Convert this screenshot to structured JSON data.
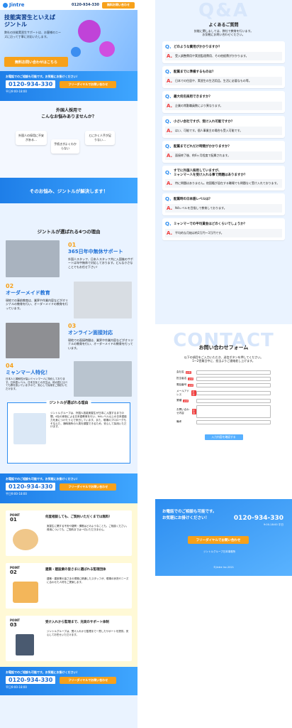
{
  "header": {
    "brand": "Jintre",
    "phone": "0120-934-330",
    "cta": "無料お問い合わせ"
  },
  "hero": {
    "title": "技能実習生といえば\nジントル",
    "sub": "弊社の技能実習生サポートは、お客様のニーズに沿って丁寧に対応いたします。",
    "cta": "無料お問い合わせはこちら"
  },
  "cta_band": {
    "lead": "お電話でのご相談も可能です。お気軽にお掛けください！",
    "phone": "0120-934-330",
    "hours": "平日9:00-18:00",
    "button": "フリーダイヤルでお問い合わせ"
  },
  "worries": {
    "title": "外国人採用で\nこんなお悩みありませんか？",
    "items": [
      "外国人の採用に不安がある…",
      "手続きがよくわからない",
      "とにかく人手が足りない…"
    ],
    "answer": "そのお悩み、ジントルが解決します！"
  },
  "reasons": {
    "title": "ジントルが選ばれる4つの理由",
    "items": [
      {
        "num": "01",
        "title": "365日年中無休サポート",
        "body": "外国人スタッフ、日本人スタッフ共に入国後のサポートは年中無休で対応しております。どんな小さなことでもお任せ下さい！"
      },
      {
        "num": "02",
        "title": "オーダーメイド教育",
        "body": "現地での事前教育は、業界や作業内容などがオリジナルの教育を行い、オーダーメイドの教育を行っています。"
      },
      {
        "num": "03",
        "title": "オンライン面接対応",
        "body": "現地での面接時間は、業界や作業内容などがオリジナルの教育を行い、オーダーメイドの教育を行っています。"
      },
      {
        "num": "04",
        "title": "ミャンマー人特化！",
        "body": "日本人と親和性が高いミャンマー人に特化しております。日本語レベル、日本文化との共生は、他の国と比べても群を抜いていますので、安心して採用をご検討いただけます。"
      }
    ]
  },
  "chosen": {
    "title": "ジントルが選ばれる理由",
    "body": "ジントルグループは、外国人技能実習生が日本に入国するまでの間、4社の体制による日本語教育を行い、N4レベル以上の日本語能力を身につけたうえで来日しています。また、現場のプロローグもそなえた、適時適所の人員を調整できるため、安心して採用いただけます。"
  },
  "points": {
    "items": [
      {
        "label": "POINT",
        "num": "01",
        "title": "何度相談しても、ご契約いただくまでは無料！",
        "body": "実習生に関する不安や疑問・課題はどのようなことも、ご相談ください。費用についても、ご契約までは一切いただきません。"
      },
      {
        "label": "POINT",
        "num": "02",
        "title": "建築・建設業の皆さまに選ばれる監理団体",
        "body": "建築・建設業の皆さまの現場に精通したスタッフが、現場の状況やニーズに合わせた人材をご提案します。"
      },
      {
        "label": "POINT",
        "num": "03",
        "title": "受け入れから監理まで、充実のサポート体制",
        "body": "ジントルグループは、受け入れから監理まで一貫したサポートを提供。安心してお任せいただけます。"
      }
    ]
  },
  "faq": {
    "watermark": "Q&A",
    "title": "よくあるご質問",
    "lead": "技能に関しましては、弊社で教育を行います。\nお気軽にお問い合わせください。",
    "items": [
      {
        "q": "どのような費用がかかりますか？",
        "a": "受入調整費用や実習監理費用、その他経費がかかります。"
      },
      {
        "q": "配属までに準備するものは？",
        "a": "日本での住居や、実習生の生活用品、生活に必要なもの等。"
      },
      {
        "q": "最大何名採用できますか？",
        "a": "企業の常勤職員数により異なります。"
      },
      {
        "q": "小さい会社ですが、受け入れ可能ですか？",
        "a": "はい、可能です。個人事業主の場合も受入可能です。"
      },
      {
        "q": "配属までどれだけ時間がかかりますか？",
        "a": "面接終了後、約6ヶ月程度で配属されます。"
      },
      {
        "q": "すでに外国人採用していますが、\nミャンマー人を受け入れる事で問題はありますか？",
        "a": "特に問題はありません。他国籍が混在する職場でも問題なく受け入れております。"
      },
      {
        "q": "配属時の日本語レベルは？",
        "a": "N4レベルを目指して教育しております。"
      },
      {
        "q": "ミャンマーでの平均賃金はどのくらいでしょうか？",
        "a": "平均的な月給は約2万円〜3万円です。"
      }
    ]
  },
  "contact": {
    "watermark": "CONTACT",
    "title": "お問い合わせフォーム",
    "lead": "以下の項目をご入力いただき、送信ボタンを押してください。\n1〜2営業日中に、担当よりご連絡差し上げます。",
    "required": "必須",
    "fields": [
      "会社名",
      "担当者名",
      "電話番号",
      "メールアドレス",
      "業種",
      "お問い合わせ内容",
      "備考"
    ],
    "submit": "入力内容を確認する"
  },
  "footer_cta": {
    "lead": "お電話でのご相談も可能です。\nお気軽にお掛けください！",
    "phone": "0120-934-330",
    "hours": "9:00-18:00 平日",
    "button": "フリーダイヤルでお問い合わせ"
  },
  "footer": {
    "company": "ジントルグループ日本事務所",
    "copyright": "©Jintre Inc.2021"
  },
  "colors": {
    "primary": "#1d6fd6",
    "accent": "#f7a11a",
    "danger": "#ef3b3b"
  }
}
